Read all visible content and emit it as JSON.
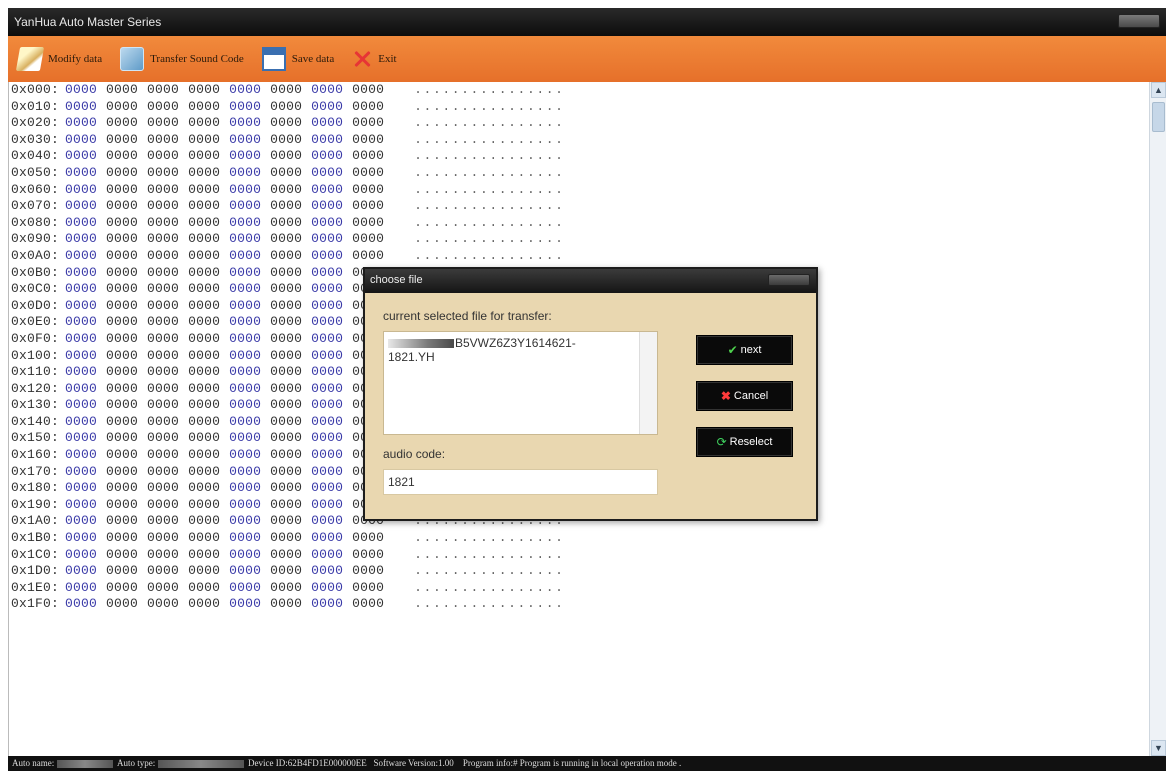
{
  "window": {
    "title": "YanHua Auto Master Series"
  },
  "toolbar": {
    "items": [
      {
        "label": "Modify data",
        "icon": "modify-icon"
      },
      {
        "label": "Transfer Sound Code",
        "icon": "transfer-icon"
      },
      {
        "label": "Save data",
        "icon": "save-icon"
      },
      {
        "label": "Exit",
        "icon": "exit-icon"
      }
    ]
  },
  "hex": {
    "rows": [
      "0x000:",
      "0x010:",
      "0x020:",
      "0x030:",
      "0x040:",
      "0x050:",
      "0x060:",
      "0x070:",
      "0x080:",
      "0x090:",
      "0x0A0:",
      "0x0B0:",
      "0x0C0:",
      "0x0D0:",
      "0x0E0:",
      "0x0F0:",
      "0x100:",
      "0x110:",
      "0x120:",
      "0x130:",
      "0x140:",
      "0x150:",
      "0x160:",
      "0x170:",
      "0x180:",
      "0x190:",
      "0x1A0:",
      "0x1B0:",
      "0x1C0:",
      "0x1D0:",
      "0x1E0:",
      "0x1F0:"
    ],
    "word": "0000",
    "ascii": "................"
  },
  "dialog": {
    "title": "choose file",
    "file_label": "current selected file for transfer:",
    "file_name_visible": "B5VWZ6Z3Y1614621-",
    "file_name_line2": "1821.YH",
    "audio_label": "audio code:",
    "audio_value": "1821",
    "next_label": "next",
    "cancel_label": "Cancel",
    "reselect_label": "Reselect"
  },
  "status": {
    "auto_name_label": "Auto name:",
    "auto_type_label": "Auto type:",
    "device_id": "Device ID:62B4FD1E000000EE",
    "software_version": "Software Version:1.00",
    "program_info": "Program info:# Program is running in local operation mode ."
  }
}
